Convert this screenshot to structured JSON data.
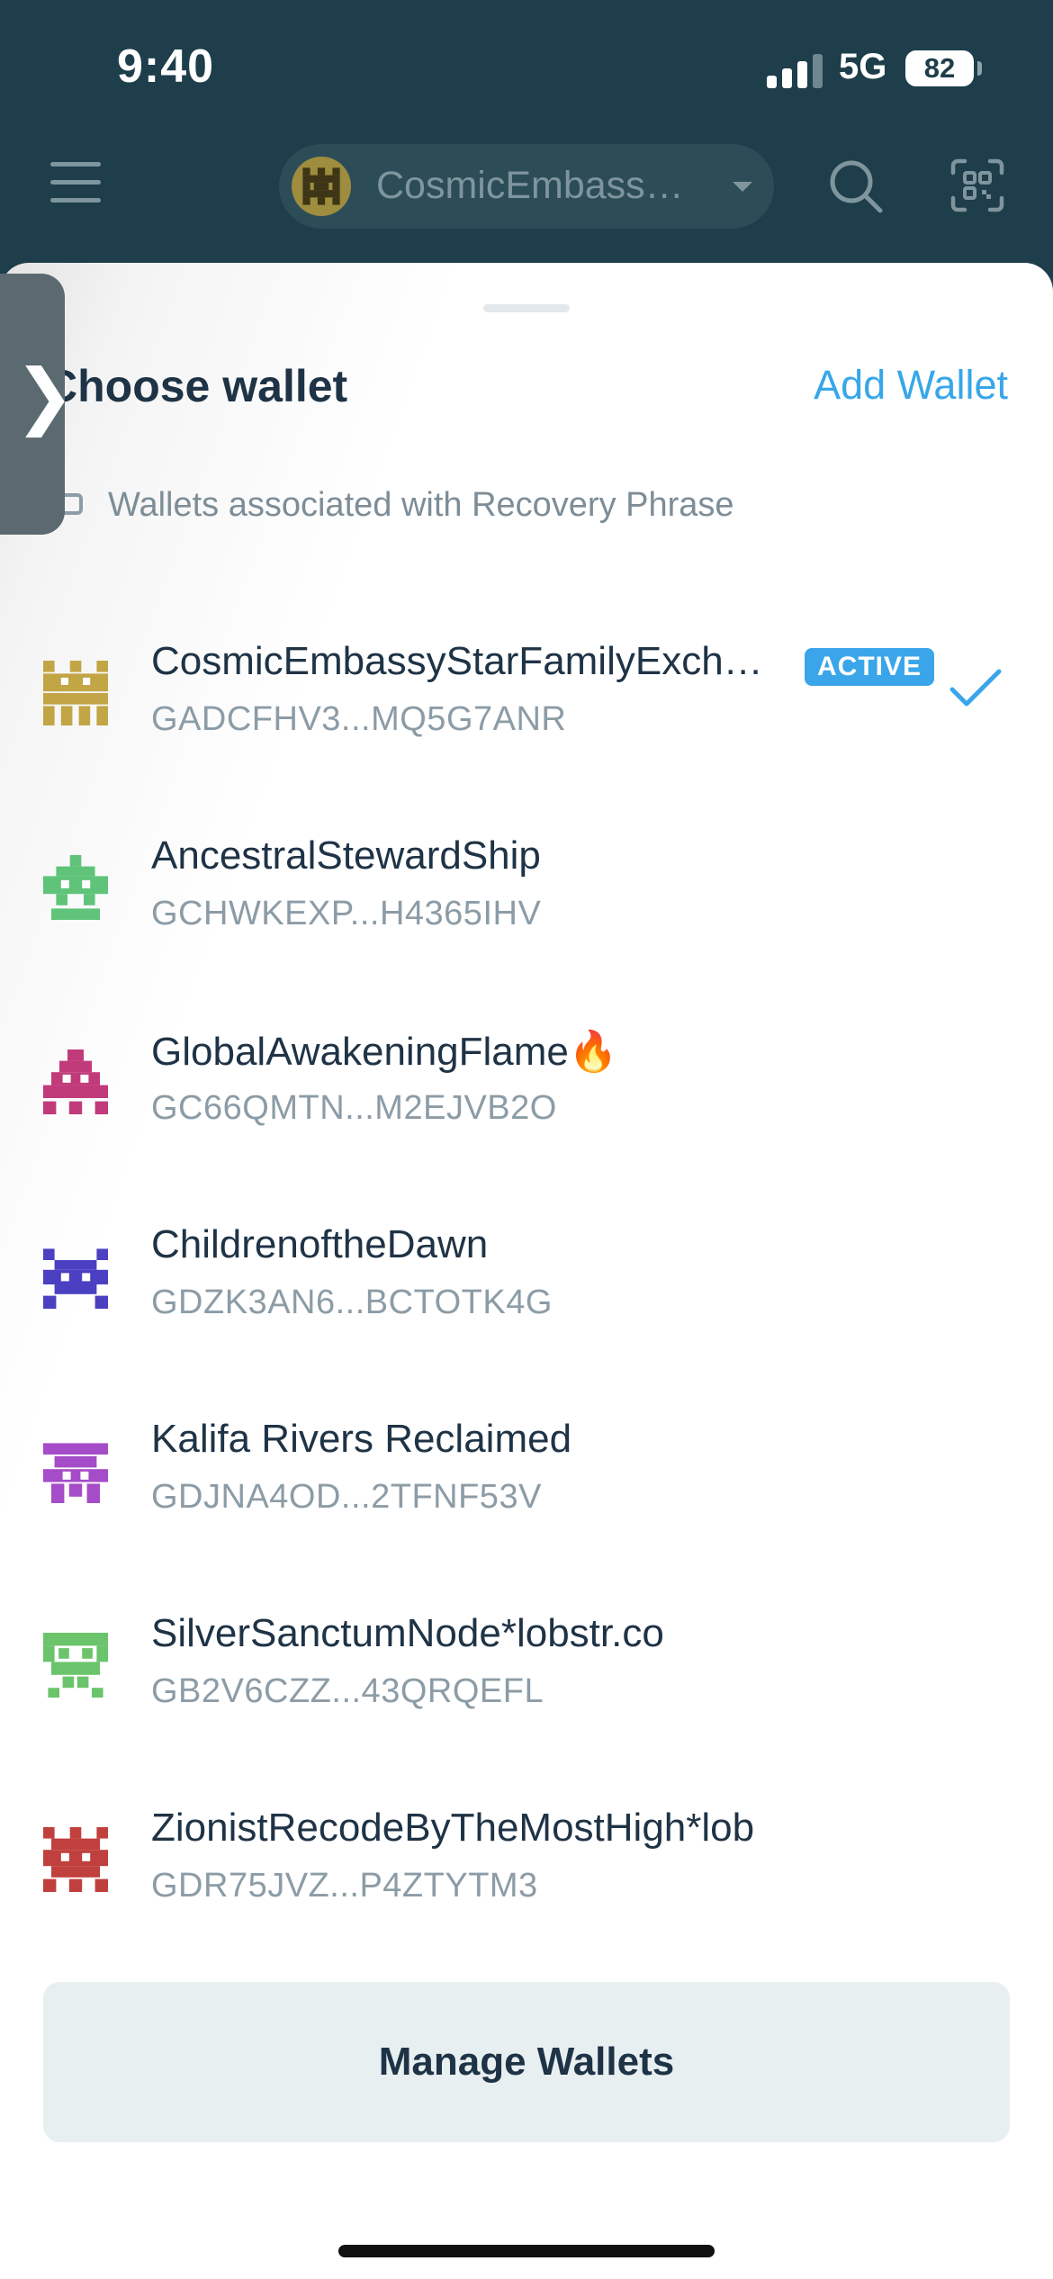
{
  "status_bar": {
    "time": "9:40",
    "network": "5G",
    "battery": "82",
    "signal_bars_active": 3,
    "signal_bars_total": 4
  },
  "header": {
    "selected_wallet": "CosmicEmbass…",
    "icons": [
      "menu-icon",
      "search-icon",
      "scan-icon",
      "chevron-down-icon"
    ]
  },
  "sheet": {
    "title": "Choose wallet",
    "add_wallet_label": "Add Wallet",
    "group_label": "Wallets associated with Recovery Phrase",
    "group_icon": "keyboard-icon",
    "active_badge": "ACTIVE",
    "manage_label": "Manage Wallets",
    "side_handle": "❯"
  },
  "wallets": [
    {
      "name": "CosmicEmbassyStarFamilyExch…",
      "address": "GADCFHV3...MQ5G7ANR",
      "active": true,
      "color": "#c2a544"
    },
    {
      "name": "AncestralStewardShip",
      "address": "GCHWKEXP...H4365IHV",
      "active": false,
      "color": "#5fc47a"
    },
    {
      "name": "GlobalAwakeningFlame🔥",
      "address": "GC66QMTN...M2EJVB2O",
      "active": false,
      "color": "#c13a7a"
    },
    {
      "name": "ChildrenoftheDawn",
      "address": "GDZK3AN6...BCTOTK4G",
      "active": false,
      "color": "#4b3fc2"
    },
    {
      "name": "Kalifa Rivers Reclaimed",
      "address": "GDJNA4OD...2TFNF53V",
      "active": false,
      "color": "#a54cc9"
    },
    {
      "name": "SilverSanctumNode*lobstr.co",
      "address": "GB2V6CZZ...43QRQEFL",
      "active": false,
      "color": "#6bc46b"
    },
    {
      "name": "ZionistRecodeByTheMostHigh*lob",
      "address": "GDR75JVZ...P4ZTYTM3",
      "active": false,
      "color": "#c0403e"
    }
  ],
  "colors": {
    "header_bg": "#1d3e4a",
    "accent": "#37a7e8",
    "text_primary": "#1f3346",
    "text_secondary": "#8c9ca6"
  }
}
